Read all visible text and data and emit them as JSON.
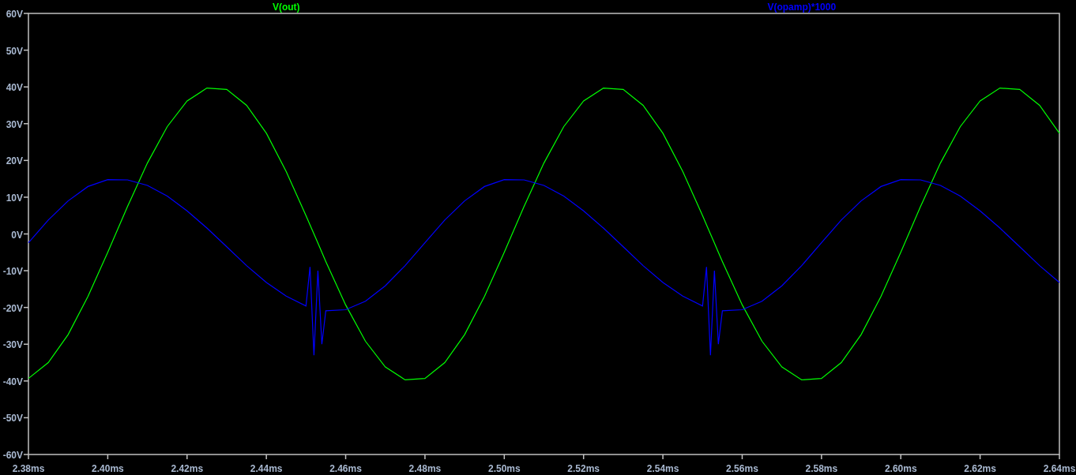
{
  "plot": {
    "chart_data": {
      "type": "line",
      "x": [
        2.38,
        2.385,
        2.39,
        2.395,
        2.4,
        2.405,
        2.41,
        2.415,
        2.42,
        2.425,
        2.43,
        2.435,
        2.44,
        2.445,
        2.45,
        2.451,
        2.452,
        2.453,
        2.454,
        2.455,
        2.46,
        2.465,
        2.47,
        2.475,
        2.48,
        2.485,
        2.49,
        2.495,
        2.5,
        2.505,
        2.51,
        2.515,
        2.52,
        2.525,
        2.53,
        2.535,
        2.54,
        2.545,
        2.55,
        2.551,
        2.552,
        2.553,
        2.554,
        2.555,
        2.56,
        2.565,
        2.57,
        2.575,
        2.58,
        2.585,
        2.59,
        2.595,
        2.6,
        2.605,
        2.61,
        2.615,
        2.62,
        2.625,
        2.63,
        2.635,
        2.64
      ],
      "series": [
        {
          "name": "V(out)",
          "color": "#00ff00",
          "values": [
            -39.3,
            -35.0,
            -27.4,
            -17.0,
            -5.0,
            7.5,
            19.3,
            29.2,
            36.2,
            39.7,
            39.3,
            35.0,
            27.4,
            17.0,
            5.0,
            2.5,
            0,
            -2.5,
            -5.0,
            -7.5,
            -19.3,
            -29.2,
            -36.2,
            -39.7,
            -39.3,
            -35.0,
            -27.4,
            -17.0,
            -5.0,
            7.5,
            19.3,
            29.2,
            36.2,
            39.7,
            39.3,
            35.0,
            27.4,
            17.0,
            5.0,
            2.5,
            0,
            -2.5,
            -5.0,
            -7.5,
            -19.3,
            -29.2,
            -36.2,
            -39.7,
            -39.3,
            -35.0,
            -27.4,
            -17.0,
            -5.0,
            7.5,
            19.3,
            29.2,
            36.2,
            39.7,
            39.3,
            35.0,
            27.4
          ]
        },
        {
          "name": "V(opamp)*1000",
          "color": "#0000ff",
          "values": [
            -2.4,
            3.8,
            9.0,
            12.9,
            14.8,
            14.7,
            13.2,
            10.3,
            6.3,
            1.6,
            -3.5,
            -8.6,
            -13.2,
            -16.9,
            -19.6,
            -9,
            -33,
            -10,
            -30,
            -20.9,
            -20.6,
            -18.3,
            -14.1,
            -8.6,
            -2.4,
            3.8,
            9.0,
            12.9,
            14.8,
            14.7,
            13.2,
            10.3,
            6.3,
            1.6,
            -3.5,
            -8.6,
            -13.2,
            -16.9,
            -19.6,
            -9,
            -33,
            -10,
            -30,
            -20.9,
            -20.6,
            -18.3,
            -14.1,
            -8.6,
            -2.4,
            3.8,
            9.0,
            12.9,
            14.8,
            14.7,
            13.2,
            10.3,
            6.3,
            1.6,
            -3.5,
            -8.6,
            -13.2
          ]
        }
      ],
      "xlim": [
        2.38,
        2.64
      ],
      "ylim": [
        -60,
        60
      ],
      "xticks": [
        {
          "value": 2.38,
          "label": "2.38ms"
        },
        {
          "value": 2.4,
          "label": "2.40ms"
        },
        {
          "value": 2.42,
          "label": "2.42ms"
        },
        {
          "value": 2.44,
          "label": "2.44ms"
        },
        {
          "value": 2.46,
          "label": "2.46ms"
        },
        {
          "value": 2.48,
          "label": "2.48ms"
        },
        {
          "value": 2.5,
          "label": "2.50ms"
        },
        {
          "value": 2.52,
          "label": "2.52ms"
        },
        {
          "value": 2.54,
          "label": "2.54ms"
        },
        {
          "value": 2.56,
          "label": "2.56ms"
        },
        {
          "value": 2.58,
          "label": "2.58ms"
        },
        {
          "value": 2.6,
          "label": "2.60ms"
        },
        {
          "value": 2.62,
          "label": "2.62ms"
        },
        {
          "value": 2.64,
          "label": "2.64ms"
        }
      ],
      "yticks": [
        {
          "value": 60,
          "label": "60V"
        },
        {
          "value": 50,
          "label": "50V"
        },
        {
          "value": 40,
          "label": "40V"
        },
        {
          "value": 30,
          "label": "30V"
        },
        {
          "value": 20,
          "label": "20V"
        },
        {
          "value": 10,
          "label": "10V"
        },
        {
          "value": 0,
          "label": "0V"
        },
        {
          "value": -10,
          "label": "-10V"
        },
        {
          "value": -20,
          "label": "-20V"
        },
        {
          "value": -30,
          "label": "-30V"
        },
        {
          "value": -40,
          "label": "-40V"
        },
        {
          "value": -50,
          "label": "-50V"
        },
        {
          "value": -60,
          "label": "-60V"
        }
      ]
    }
  }
}
